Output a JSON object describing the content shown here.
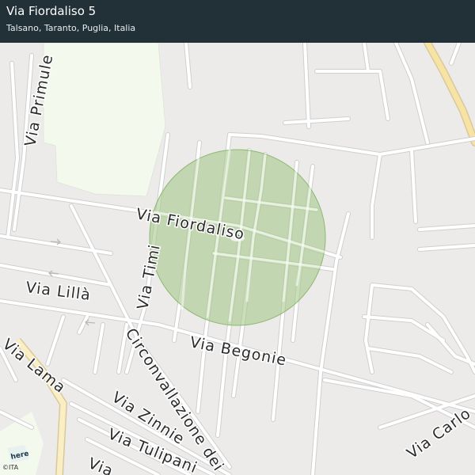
{
  "location": {
    "title": "Via Fiordaliso 5",
    "subtitle": "Talsano, Taranto, Puglia, Italia"
  },
  "streets": {
    "fiordaliso": "Via Fiordaliso",
    "primule": "Via Primule",
    "timi": "Via Timi",
    "lilla": "Via Lillà",
    "begonie": "Via Begonie",
    "lama": "Via Lama",
    "circonvallazione": "Circonvallazione dei",
    "zinnie": "Via Zinnie",
    "tulipani": "Via Tulipani",
    "partial": "Via",
    "carlo": "Via Carlo"
  },
  "map": {
    "accuracy_circle_color": "#b3d19a",
    "marker_color": "#2f8a3a",
    "park_color": "#f4f9ee",
    "main_road_color": "#f7e3a3",
    "background_color": "#ecebea",
    "road_color": "#ffffff"
  },
  "attribution": {
    "brand": "here",
    "copyright": "©ITA"
  }
}
